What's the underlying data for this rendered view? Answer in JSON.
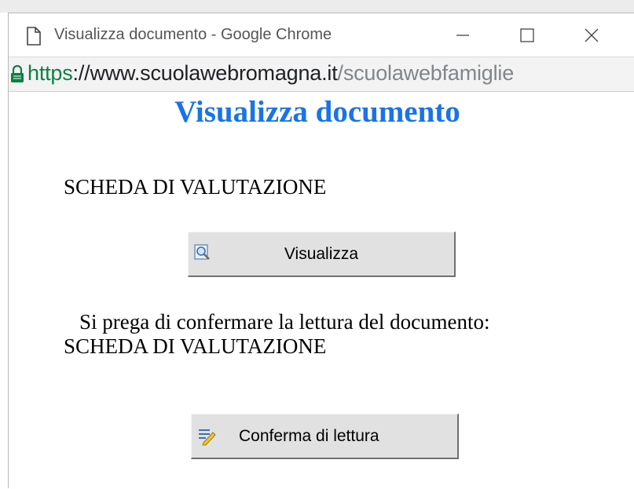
{
  "window": {
    "title": "Visualizza documento - Google Chrome",
    "url_scheme": "https",
    "url_sep": "://",
    "url_host": "www.scuolawebromagna.it",
    "url_path": "/scuolawebfamiglie"
  },
  "page": {
    "heading": "Visualizza documento",
    "document_name": "SCHEDA DI VALUTAZIONE",
    "view_button_label": "Visualizza",
    "prompt_text": "Si prega di confermare la lettura del documento:",
    "prompt_document_name": "SCHEDA DI VALUTAZIONE",
    "confirm_button_label": "Conferma di lettura"
  },
  "colors": {
    "heading": "#1a73e8",
    "url_scheme": "#0b8043",
    "button_bg": "#e1e1e1"
  },
  "icons": {
    "tab": "document-icon",
    "secure": "lock-icon",
    "view": "magnifier-icon",
    "confirm": "edit-icon"
  }
}
